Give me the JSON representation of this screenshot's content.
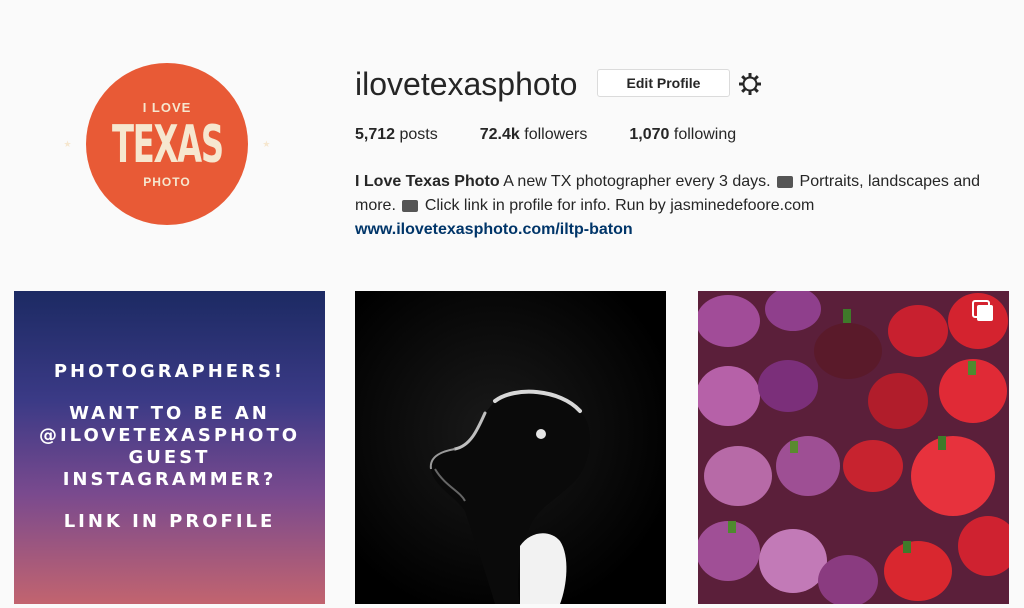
{
  "profile": {
    "avatar": {
      "line1": "I LOVE",
      "line2": "TEXAS",
      "line3": "PHOTO"
    },
    "username": "ilovetexasphoto",
    "edit_label": "Edit Profile",
    "stats": {
      "posts_count": "5,712",
      "posts_label": "posts",
      "followers_count": "72.4k",
      "followers_label": "followers",
      "following_count": "1,070",
      "following_label": "following"
    },
    "bio": {
      "name": "I Love Texas Photo",
      "text1": "A new TX photographer every 3 days.",
      "text2": "Portraits, landscapes and more.",
      "text3": "Click link in profile for info. Run by jasminedefoore.com",
      "link": "www.ilovetexasphoto.com/iltp-baton"
    }
  },
  "posts": [
    {
      "type": "promo",
      "lines": [
        "PHOTOGRAPHERS!",
        "WANT TO BE AN\n@ILOVETEXASPHOTO\nGUEST\nINSTAGRAMMER?",
        "LINK IN PROFILE"
      ]
    },
    {
      "type": "photo",
      "subject": "dog silhouette"
    },
    {
      "type": "photo",
      "subject": "peppers",
      "icon": "multiple-photos-icon"
    }
  ]
}
